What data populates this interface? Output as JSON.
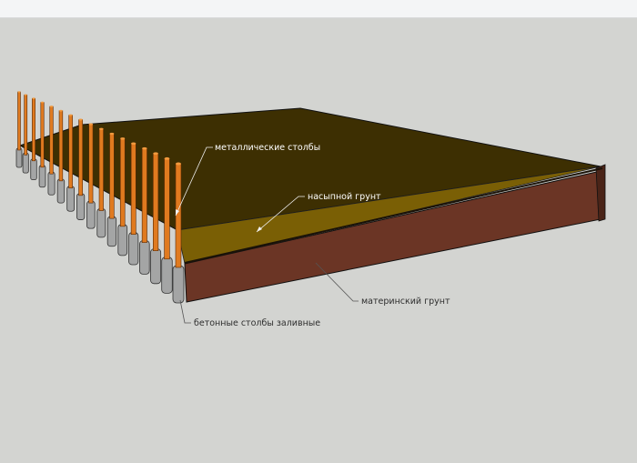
{
  "labels": {
    "metal_posts": "металлические столбы",
    "fill_soil": "насыпной грунт",
    "native_soil": "материнский грунт",
    "concrete_posts": "бетонные столбы заливные"
  },
  "colors": {
    "background": "#d3d4d1",
    "top_surface": "#3d2f02",
    "fill_soil": "#7a5f05",
    "native_soil": "#6b3525",
    "metal_post": "#e07a1f",
    "concrete_post": "#a4a5a5"
  }
}
